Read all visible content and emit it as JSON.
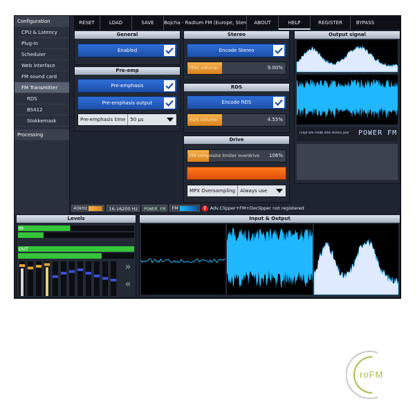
{
  "sidebar": {
    "items": [
      {
        "label": "Configuration",
        "kind": "cat"
      },
      {
        "label": "CPU & Latency",
        "kind": "item"
      },
      {
        "label": "Plug-in",
        "kind": "item"
      },
      {
        "label": "Scheduler",
        "kind": "item"
      },
      {
        "label": "Web interface",
        "kind": "item"
      },
      {
        "label": "FM sound card",
        "kind": "item"
      },
      {
        "label": "FM Transmitter",
        "kind": "active"
      },
      {
        "label": "RDS",
        "kind": "sub"
      },
      {
        "label": "BS412",
        "kind": "sub"
      },
      {
        "label": "Stokkemask",
        "kind": "sub"
      },
      {
        "label": "Processing",
        "kind": "cat"
      }
    ]
  },
  "toolbar": {
    "reset": "RESET",
    "load": "LOAD",
    "save": "SAVE",
    "preset": "Bojcha - Radium FM (Europe, Stereo",
    "about": "ABOUT",
    "help": "HELP",
    "register": "REGISTER",
    "bypass": "BYPASS"
  },
  "general": {
    "title": "General",
    "enabled_label": "Enabled",
    "enabled": true
  },
  "preemp": {
    "title": "Pre-emp",
    "preemphasis_label": "Pre-emphasis",
    "preemphasis_on": true,
    "output_label": "Pre-emphasis output",
    "output_on": true,
    "time_label": "Pre-emphasis time",
    "time_value": "50 µs"
  },
  "stereo": {
    "title": "Stereo",
    "encode_label": "Encode Stereo",
    "encode_on": true,
    "pilot_label": "Pilot volume",
    "pilot_value": "9.00%",
    "pilot_fill": 0.35
  },
  "rds": {
    "title": "RDS",
    "encode_label": "Encode RDS",
    "encode_on": true,
    "volume_label": "RDS volume",
    "volume_value": "4.55%",
    "volume_fill": 0.35
  },
  "drive": {
    "title": "Drive",
    "overdrive_label": "FM composite limiter overdrive",
    "overdrive_value": "106%",
    "overdrive_fill": 0.22,
    "drive_fill": 1.0,
    "mpx_label": "MPX Oversampling",
    "mpx_value": "Always use"
  },
  "output_signal": {
    "title": "Output signal",
    "rds_text": "Tirojd Ste Frkdb sthk dsmks jisar",
    "rds_ps": "POWER FM"
  },
  "status": {
    "khz": "40kHz",
    "hz_range": "16-16200 Hz",
    "ps": "POWER FM",
    "fm": "FM",
    "message": "Adv.Clipper+FM+Declipper not registered"
  },
  "levels": {
    "title": "Levels",
    "in_label": "IN",
    "out_label": "OUT",
    "in_fill": [
      0.45,
      0.22
    ],
    "out_fill": [
      1.0,
      0.72
    ],
    "bands": [
      0.92,
      0.85,
      0.9,
      0.95,
      0.6,
      0.7,
      0.75,
      0.8,
      0.7,
      0.62,
      0.55,
      0.5
    ]
  },
  "io": {
    "title": "Input & Output"
  },
  "logo": {
    "text": "roFM"
  },
  "colors": {
    "accent_blue": "#2f6fd9",
    "slider_orange": "#f0a43c",
    "waveform_cyan": "#1fb8ff",
    "level_green": "#35c43a",
    "warning_red": "#e51f1f"
  }
}
